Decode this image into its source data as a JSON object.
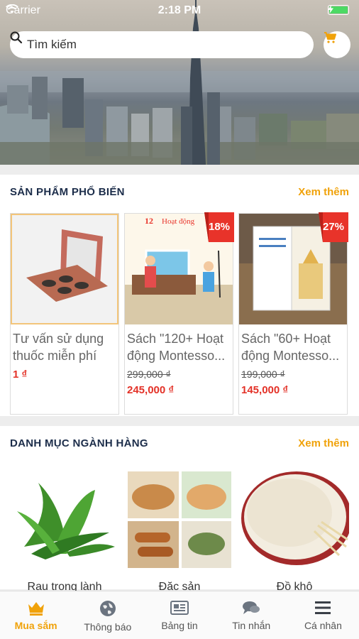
{
  "status_bar": {
    "carrier": "Carrier",
    "time": "2:18 PM"
  },
  "search": {
    "placeholder": "Tìm kiếm"
  },
  "popular": {
    "title": "SẢN PHẨM PHỔ BIẾN",
    "more": "Xem thêm",
    "products": [
      {
        "name": "Tư vấn sử dụng thuốc miễn phí",
        "old_price": "",
        "price": "1 ₫",
        "badge": ""
      },
      {
        "name": "Sách \"120+ Hoạt động Montesso...",
        "old_price": "299,000 ₫",
        "price": "245,000 ₫",
        "badge": "18%"
      },
      {
        "name": "Sách \"60+ Hoạt động Montesso...",
        "old_price": "199,000 ₫",
        "price": "145,000 ₫",
        "badge": "27%"
      }
    ]
  },
  "categories": {
    "title": "DANH MỤC NGÀNH HÀNG",
    "more": "Xem thêm",
    "items": [
      {
        "label": "Rau trong lành"
      },
      {
        "label": "Đặc sản"
      },
      {
        "label": "Đồ khô"
      }
    ]
  },
  "tabbar": {
    "tabs": [
      {
        "label": "Mua sắm",
        "icon": "shop-crown-icon",
        "active": true
      },
      {
        "label": "Thông báo",
        "icon": "globe-icon",
        "active": false
      },
      {
        "label": "Bảng tin",
        "icon": "news-card-icon",
        "active": false
      },
      {
        "label": "Tin nhắn",
        "icon": "chat-bubbles-icon",
        "active": false
      },
      {
        "label": "Cá nhân",
        "icon": "menu-icon",
        "active": false
      }
    ]
  },
  "colors": {
    "accent": "#f0a20a",
    "price": "#e33127",
    "badge": "#e8332a",
    "title": "#1c2d4a"
  }
}
